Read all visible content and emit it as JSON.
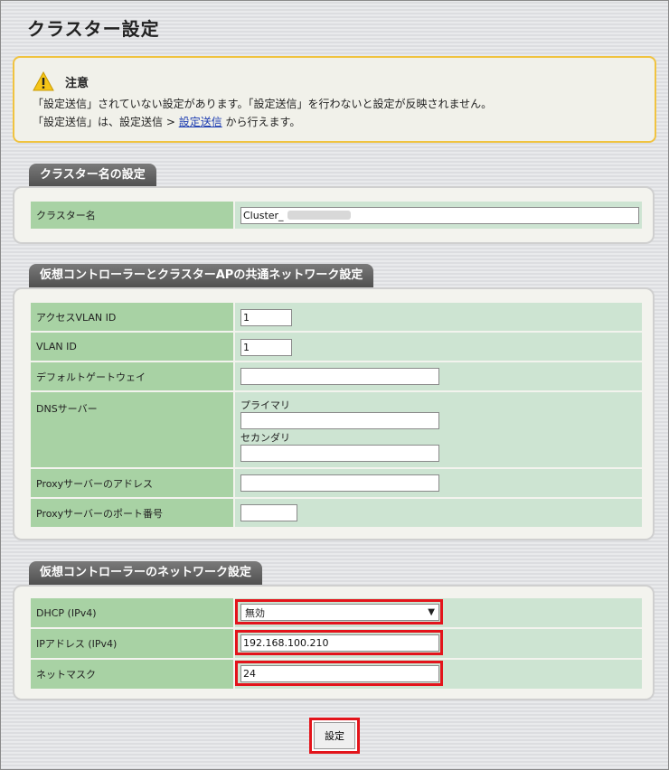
{
  "page_title": "クラスター設定",
  "notice": {
    "title": "注意",
    "line1": "「設定送信」されていない設定があります。「設定送信」を行わないと設定が反映されません。",
    "line2_prefix": "「設定送信」は、設定送信 > ",
    "line2_link": "設定送信",
    "line2_suffix": " から行えます。",
    "icon": "warning-icon",
    "border_color": "#f0c340"
  },
  "cluster_section": {
    "title": "クラスター名の設定",
    "name_label": "クラスター名",
    "name_value": "Cluster_"
  },
  "shared_network_section": {
    "title": "仮想コントローラーとクラスターAPの共通ネットワーク設定",
    "access_vlan_label": "アクセスVLAN ID",
    "access_vlan_value": "1",
    "vlan_label": "VLAN ID",
    "vlan_value": "1",
    "gateway_label": "デフォルトゲートウェイ",
    "gateway_value": "",
    "dns_label": "DNSサーバー",
    "dns_primary_label": "プライマリ",
    "dns_primary_value": "",
    "dns_secondary_label": "セカンダリ",
    "dns_secondary_value": "",
    "proxy_address_label": "Proxyサーバーのアドレス",
    "proxy_address_value": "",
    "proxy_port_label": "Proxyサーバーのポート番号",
    "proxy_port_value": ""
  },
  "controller_section": {
    "title": "仮想コントローラーのネットワーク設定",
    "dhcp_label": "DHCP (IPv4)",
    "dhcp_value": "無効",
    "ip_label": "IPアドレス (IPv4)",
    "ip_value": "192.168.100.210",
    "netmask_label": "ネットマスク",
    "netmask_value": "24"
  },
  "submit_label": "設定",
  "colors": {
    "label_bg": "#a8d2a4",
    "value_bg": "#cde4d2",
    "highlight": "#e3141b"
  }
}
